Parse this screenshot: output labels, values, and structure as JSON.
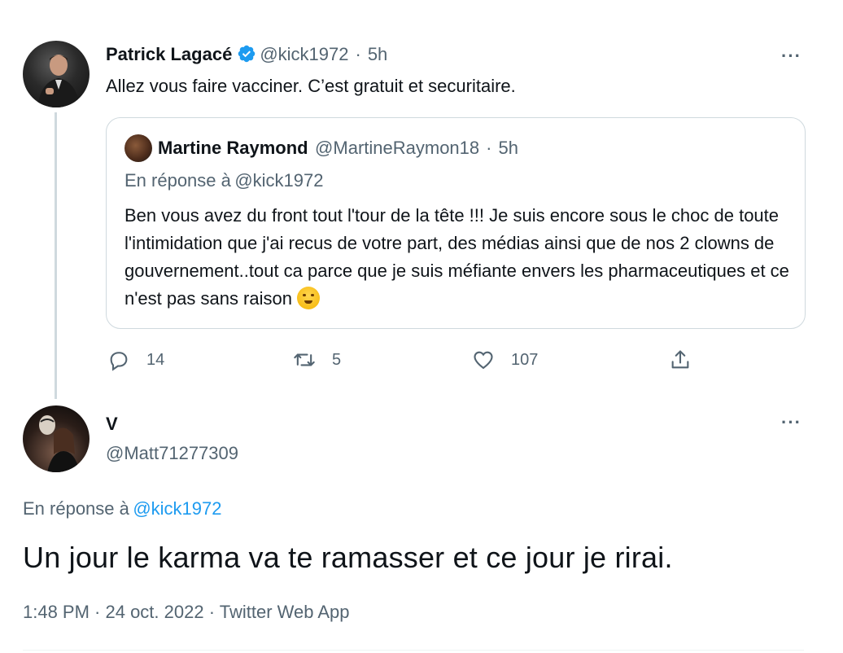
{
  "tweet1": {
    "name": "Patrick Lagacé",
    "handle": "@kick1972",
    "separator": "·",
    "time": "5h",
    "text": "Allez vous faire vacciner. C’est gratuit et securitaire.",
    "quote": {
      "name": "Martine Raymond",
      "handle": "@MartineRaymon18",
      "separator": "·",
      "time": "5h",
      "reply_prefix": "En réponse à",
      "reply_to": "@kick1972",
      "text": "Ben vous avez du front tout l'tour de la tête !!! Je suis encore sous le choc de toute l'intimidation que j'ai recus de votre part, des médias ainsi que de nos 2 clowns de gouvernement..tout ca parce que je suis méfiante envers les pharmaceutiques et ce n'est pas sans raison",
      "emoji": "confounded-steam-face"
    },
    "actions": {
      "replies": "14",
      "retweets": "5",
      "likes": "107"
    },
    "more": "···"
  },
  "tweet2": {
    "name": "V",
    "handle": "@Matt71277309",
    "reply_prefix": "En réponse à",
    "reply_to": "@kick1972",
    "text": "Un jour le karma va te ramasser et ce jour je rirai.",
    "timestamp": "1:48 PM · 24 oct. 2022 · Twitter Web App",
    "more": "···"
  },
  "colors": {
    "primary_text": "#0f1419",
    "secondary_text": "#536471",
    "link": "#1d9bf0",
    "border": "#cfd9de",
    "verified": "#1d9bf0"
  }
}
